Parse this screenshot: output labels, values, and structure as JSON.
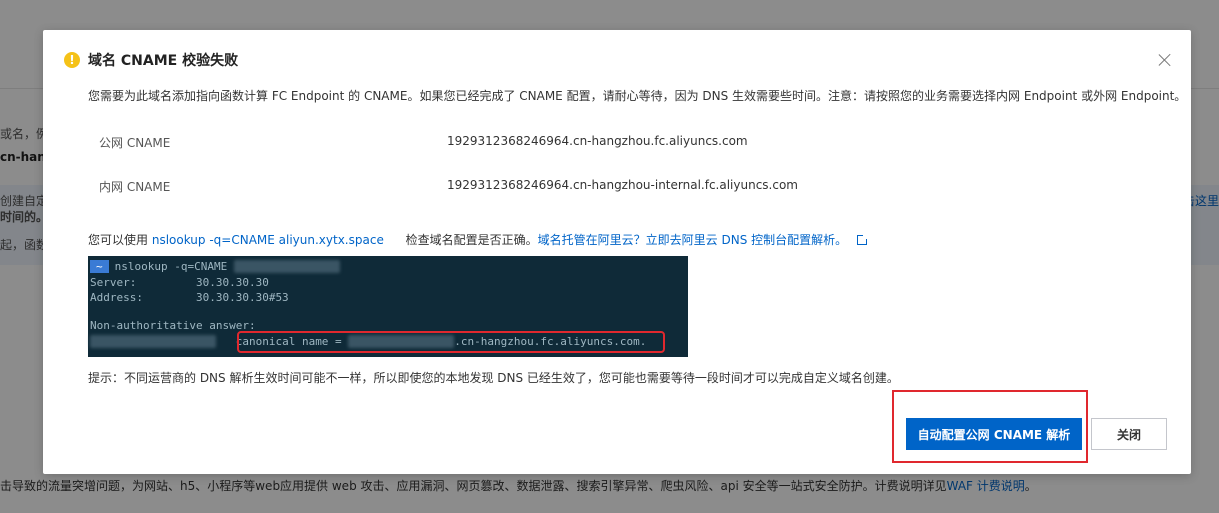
{
  "background": {
    "frag_domain_hint": "或名，例",
    "frag_cn_hang": "cn-hang",
    "frag_create": "创建自定",
    "frag_same": "时间的。",
    "frag_start": "起，函数",
    "frag_link_right": "击这里",
    "frag_bottom": "击导致的流量突增问题，为网站、h5、小程序等web应用提供 web 攻击、应用漏洞、网页篡改、数据泄露、搜索引擎异常、爬虫风险、api 安全等一站式安全防护。计费说明详见",
    "frag_bottom_link": "WAF 计费说明",
    "frag_bottom_end": "。"
  },
  "dialog": {
    "title": "域名 CNAME 校验失败",
    "description": "您需要为此域名添加指向函数计算 FC Endpoint 的 CNAME。如果您已经完成了 CNAME 配置，请耐心等待，因为 DNS 生效需要些时间。注意：请按照您的业务需要选择内网 Endpoint 或外网 Endpoint。",
    "cname_rows": [
      {
        "label": "公网 CNAME",
        "value": "1929312368246964.cn-hangzhou.fc.aliyuncs.com"
      },
      {
        "label": "内网 CNAME",
        "value": "1929312368246964.cn-hangzhou-internal.fc.aliyuncs.com"
      }
    ],
    "nslookup": {
      "prefix": "您可以使用",
      "command": "nslookup -q=CNAME aliyun.xytx.space",
      "middle": "检查域名配置是否正确。",
      "link": "域名托管在阿里云？立即去阿里云 DNS 控制台配置解析。"
    },
    "terminal": {
      "prompt": "~",
      "cmd": "nslookup -q=CNAME ",
      "server_label": "Server:",
      "server_value": "30.30.30.30",
      "address_label": "Address:",
      "address_value": "30.30.30.30#53",
      "nonauth": "Non-authoritative answer:",
      "canonical_prefix": "canonical name = ",
      "canonical_suffix": ".cn-hangzhou.fc.aliyuncs.com."
    },
    "tip": "提示：不同运营商的 DNS 解析生效时间可能不一样，所以即使您的本地发现 DNS 已经生效了，您可能也需要等待一段时间才可以完成自定义域名创建。",
    "primary_button": "自动配置公网 CNAME 解析",
    "close_button": "关闭"
  },
  "colors": {
    "primary": "#0064c8",
    "warning": "#f5c218",
    "annotation_red": "#e0282e",
    "terminal_bg": "#0f2a38"
  },
  "icons": [
    "warning-icon",
    "close-icon",
    "external-link-icon"
  ]
}
